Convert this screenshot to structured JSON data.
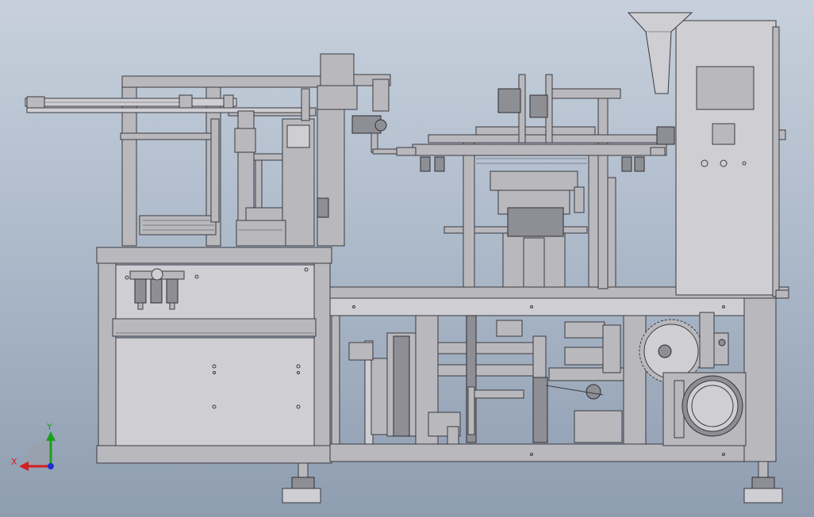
{
  "viewport": {
    "background_top": "#c7d0dc",
    "background_bottom": "#8f9db1"
  },
  "model": {
    "description_icon": "packaging-machine-front-view",
    "part_color": "#b9b9bd",
    "edge_color": "#3a3a40"
  },
  "triad": {
    "x_label": "X",
    "y_label": "Y",
    "x_color": "#d42020",
    "y_color": "#1aa01a",
    "z_color": "#2030d0"
  }
}
